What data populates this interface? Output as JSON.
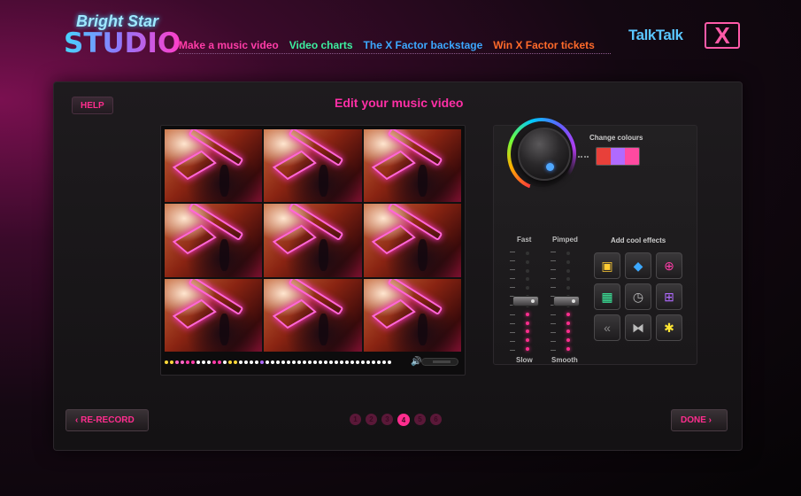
{
  "logo": {
    "line1": "Bright Star",
    "line2": "STUDIO"
  },
  "nav": [
    {
      "label": "Make a music video",
      "color": "#ff3ca8"
    },
    {
      "label": "Video charts",
      "color": "#3cf0a0"
    },
    {
      "label": "The X Factor backstage",
      "color": "#3ca8ff"
    },
    {
      "label": "Win X Factor tickets",
      "color": "#ff6a2a"
    }
  ],
  "partner": {
    "talktalk": "TalkTalk",
    "xfactor": "X"
  },
  "panel": {
    "help_label": "HELP",
    "title": "Edit your music video"
  },
  "colors": {
    "accent": "#ff2d8e",
    "title": "#ff2fa6"
  },
  "video": {
    "progress_dots": [
      "#ffd93a",
      "#ffd93a",
      "#ff6ac8",
      "#ff6ac8",
      "#ff3ca8",
      "#ff3ca8",
      "#ffffff",
      "#ffffff",
      "#ffffff",
      "#ff3ca8",
      "#ff3ca8",
      "#ffffff",
      "#ffd93a",
      "#ffd93a",
      "#ffffff",
      "#ffffff",
      "#ffffff",
      "#ffffff",
      "#b06aff",
      "#ffffff",
      "#ffffff",
      "#ffffff",
      "#ffffff",
      "#ffffff",
      "#ffffff",
      "#ffffff",
      "#ffffff",
      "#ffffff",
      "#ffffff",
      "#ffffff",
      "#ffffff",
      "#ffffff",
      "#ffffff",
      "#ffffff",
      "#ffffff",
      "#ffffff",
      "#ffffff",
      "#ffffff",
      "#ffffff",
      "#ffffff",
      "#ffffff",
      "#ffffff",
      "#ffffff"
    ],
    "volume_icon": "speaker-icon"
  },
  "colour_picker": {
    "label": "Change colours",
    "swatch": [
      "#e8403a",
      "#b06aff",
      "#ff4aa0"
    ]
  },
  "sliders": [
    {
      "top_label": "Fast",
      "bottom_label": "Slow",
      "level": 0.55
    },
    {
      "top_label": "Pimped",
      "bottom_label": "Smooth",
      "level": 0.55
    }
  ],
  "effects": {
    "label": "Add cool effects",
    "items": [
      {
        "name": "overlay-effect-icon",
        "glyph": "▣",
        "color": "#ffcc33"
      },
      {
        "name": "droplet-effect-icon",
        "glyph": "◆",
        "color": "#3ca8ff"
      },
      {
        "name": "zoom-effect-icon",
        "glyph": "⊕",
        "color": "#ff3ca8"
      },
      {
        "name": "frame-effect-icon",
        "glyph": "▦",
        "color": "#3cf0a0"
      },
      {
        "name": "clock-effect-icon",
        "glyph": "◷",
        "color": "#bbbbbb"
      },
      {
        "name": "grid-effect-icon",
        "glyph": "⊞",
        "color": "#b06aff"
      },
      {
        "name": "rewind-effect-icon",
        "glyph": "«",
        "color": "#888888"
      },
      {
        "name": "mirror-effect-icon",
        "glyph": "⧓",
        "color": "#bbbbbb"
      },
      {
        "name": "burst-effect-icon",
        "glyph": "✱",
        "color": "#ffe633"
      }
    ]
  },
  "bottom": {
    "rerecord_label": "‹ RE-RECORD",
    "done_label": "DONE ›",
    "pages": [
      "1",
      "2",
      "3",
      "4",
      "5",
      "6"
    ],
    "current_page": "4"
  }
}
